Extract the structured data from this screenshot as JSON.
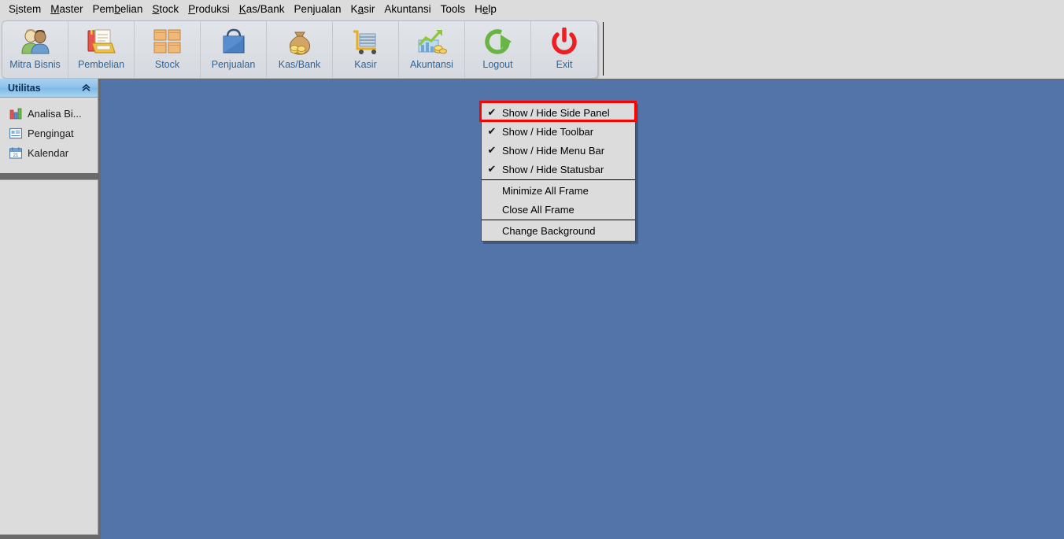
{
  "menubar": {
    "items": [
      {
        "label": "Sistem",
        "accel_index": 1
      },
      {
        "label": "Master",
        "accel_index": 0
      },
      {
        "label": "Pembelian",
        "accel_index": 3
      },
      {
        "label": "Stock",
        "accel_index": 0
      },
      {
        "label": "Produksi",
        "accel_index": 0
      },
      {
        "label": "Kas/Bank",
        "accel_index": 0
      },
      {
        "label": "Penjualan",
        "accel_index": -1
      },
      {
        "label": "Kasir",
        "accel_index": 1
      },
      {
        "label": "Akuntansi",
        "accel_index": -1
      },
      {
        "label": "Tools",
        "accel_index": -1
      },
      {
        "label": "Help",
        "accel_index": 1
      }
    ]
  },
  "toolbar": {
    "buttons": [
      {
        "label": "Mitra Bisnis",
        "icon": "two-people-icon"
      },
      {
        "label": "Pembelian",
        "icon": "ledger-books-icon"
      },
      {
        "label": "Stock",
        "icon": "boxes-icon"
      },
      {
        "label": "Penjualan",
        "icon": "shopping-bag-icon"
      },
      {
        "label": "Kas/Bank",
        "icon": "money-bag-icon"
      },
      {
        "label": "Kasir",
        "icon": "shopping-cart-icon"
      },
      {
        "label": "Akuntansi",
        "icon": "growth-chart-coins-icon"
      },
      {
        "label": "Logout",
        "icon": "logout-arrow-icon"
      },
      {
        "label": "Exit",
        "icon": "power-off-icon"
      }
    ]
  },
  "sidepanel": {
    "header": {
      "title": "Utilitas",
      "chevron": "«"
    },
    "items": [
      {
        "label": "Analisa Bi...",
        "icon": "bar-chart-icon"
      },
      {
        "label": "Pengingat",
        "icon": "note-reminder-icon"
      },
      {
        "label": "Kalendar",
        "icon": "calendar-icon"
      }
    ]
  },
  "context_menu": {
    "checkmark": "✔",
    "items": [
      {
        "label": "Show / Hide Side Panel",
        "checked": true,
        "highlighted": true
      },
      {
        "label": "Show / Hide Toolbar",
        "checked": true,
        "highlighted": false
      },
      {
        "label": "Show / Hide Menu Bar",
        "checked": true,
        "highlighted": false
      },
      {
        "label": "Show / Hide Statusbar",
        "checked": true,
        "highlighted": false
      },
      {
        "label": "Minimize All Frame",
        "checked": false,
        "highlighted": false
      },
      {
        "label": "Close All Frame",
        "checked": false,
        "highlighted": false
      },
      {
        "label": "Change Background",
        "checked": false,
        "highlighted": false
      }
    ]
  },
  "colors": {
    "workspace_background": "#5274a8",
    "chrome_background": "#dcdcdc",
    "panel_header_blue": "#8dc2ea",
    "toolbar_label_blue": "#2f6496",
    "highlight_red": "#ff0000"
  }
}
